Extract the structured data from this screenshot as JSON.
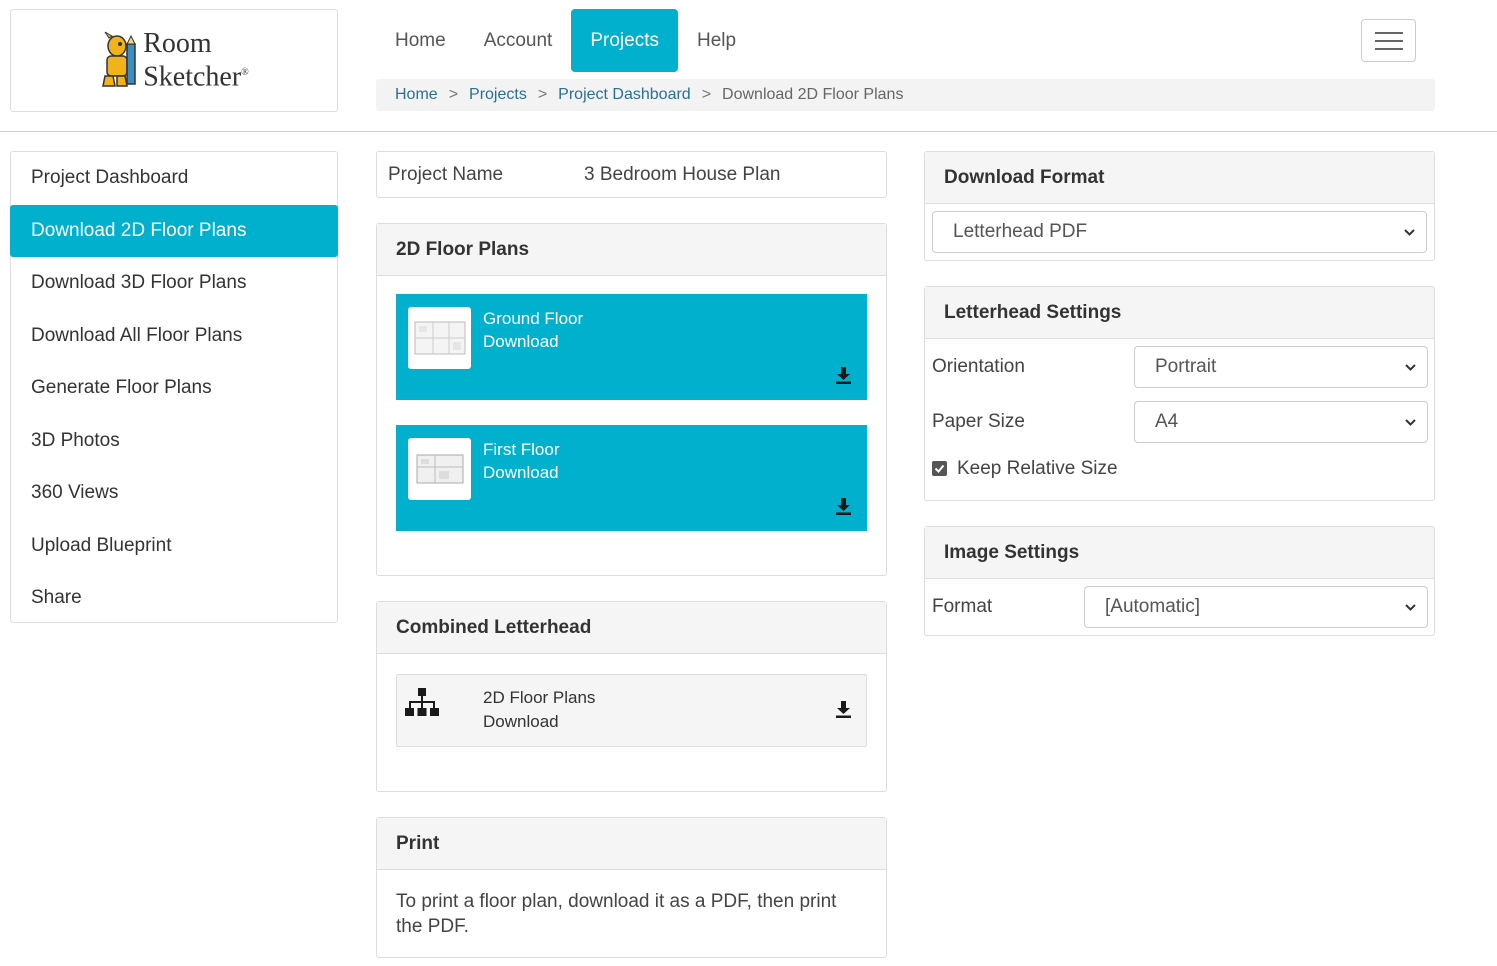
{
  "logo": {
    "line1": "Room",
    "line2": "Sketcher",
    "mark": "®"
  },
  "nav": {
    "items": [
      {
        "label": "Home",
        "active": false
      },
      {
        "label": "Account",
        "active": false
      },
      {
        "label": "Projects",
        "active": true
      },
      {
        "label": "Help",
        "active": false
      }
    ]
  },
  "breadcrumb": {
    "items": [
      "Home",
      "Projects",
      "Project Dashboard"
    ],
    "separator": ">",
    "current": "Download 2D Floor Plans"
  },
  "sidebar": {
    "items": [
      {
        "label": "Project Dashboard",
        "active": false
      },
      {
        "label": "Download 2D Floor Plans",
        "active": true
      },
      {
        "label": "Download 3D Floor Plans",
        "active": false
      },
      {
        "label": "Download All Floor Plans",
        "active": false
      },
      {
        "label": "Generate Floor Plans",
        "active": false
      },
      {
        "label": "3D Photos",
        "active": false
      },
      {
        "label": "360 Views",
        "active": false
      },
      {
        "label": "Upload Blueprint",
        "active": false
      },
      {
        "label": "Share",
        "active": false
      }
    ]
  },
  "project": {
    "label": "Project Name",
    "value": "3 Bedroom House Plan"
  },
  "floor_plans": {
    "title": "2D Floor Plans",
    "cards": [
      {
        "name": "Ground Floor",
        "action": "Download",
        "icon": "download-icon"
      },
      {
        "name": "First Floor",
        "action": "Download",
        "icon": "download-icon"
      }
    ]
  },
  "combined": {
    "title": "Combined Letterhead",
    "card": {
      "name": "2D Floor Plans",
      "action": "Download",
      "icon": "sitemap-icon"
    }
  },
  "print": {
    "title": "Print",
    "text": "To print a floor plan, download it as a PDF, then print the PDF."
  },
  "download_format": {
    "title": "Download Format",
    "selected": "Letterhead PDF"
  },
  "letterhead": {
    "title": "Letterhead Settings",
    "orientation_label": "Orientation",
    "orientation_value": "Portrait",
    "paper_label": "Paper Size",
    "paper_value": "A4",
    "keep_label": "Keep Relative Size",
    "keep_checked": true
  },
  "image_settings": {
    "title": "Image Settings",
    "format_label": "Format",
    "format_value": "[Automatic]"
  },
  "colors": {
    "accent": "#00b0cc",
    "link": "#2a6f97"
  }
}
